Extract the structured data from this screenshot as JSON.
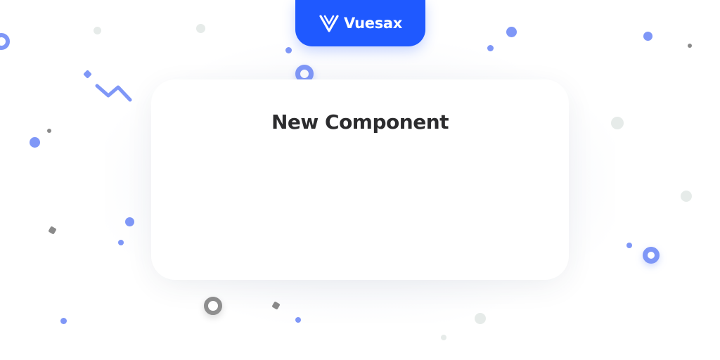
{
  "brand": {
    "name": "Vuesax",
    "logo_icon": "vuesax-v-logo-icon",
    "color": "#1f59ff"
  },
  "card": {
    "title": "New Component"
  },
  "colors": {
    "accent_blue": "#7f97f7",
    "soft_gray": "#e6ebe9",
    "dark_gray": "#8a8a8a",
    "ring_gray": "#8f8f8f"
  }
}
